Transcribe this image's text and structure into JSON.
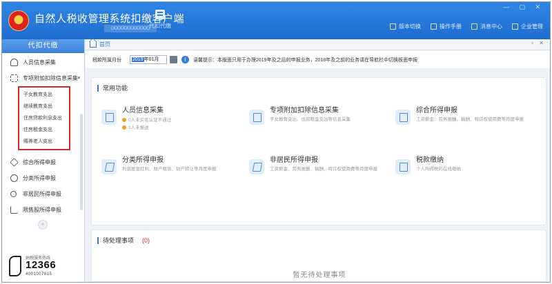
{
  "app": {
    "title": "自然人税收管理系统扣缴客户端",
    "subtitle": "（XXXXXXXXXXX）",
    "agent_label": "代扣代缴",
    "window_controls": "— ▢ ✕"
  },
  "topnav": [
    {
      "label": "版本切换"
    },
    {
      "label": "操作手册"
    },
    {
      "label": "消息中心"
    },
    {
      "label": "企业管理"
    }
  ],
  "sidebar": {
    "header": "代扣代缴",
    "items": [
      {
        "label": "人员信息采集"
      },
      {
        "label": "专项附加扣除信息采集"
      },
      {
        "label": "综合所得申报"
      },
      {
        "label": "分类所得申报"
      },
      {
        "label": "非居民所得申报"
      },
      {
        "label": "限售股所得申报"
      }
    ],
    "sub_items": [
      {
        "label": "子女教育支出"
      },
      {
        "label": "继续教育支出"
      },
      {
        "label": "住房贷款利息支出"
      },
      {
        "label": "住房租金支出"
      },
      {
        "label": "赡养老人支出"
      }
    ],
    "collapse_symbol": "«",
    "hotline": {
      "caption": "纳税服务热线",
      "number": "12366",
      "sub_number": "4001007815"
    }
  },
  "tab": {
    "label": "首页",
    "controls": "▫ ✕"
  },
  "period": {
    "label": "税款所属月份",
    "year": "2019",
    "month": "年01月",
    "tip": "温馨提示：本版面只用于办理2019年及之后的申报业务，2018年及之前的业务请在导航栏中切换板面申报"
  },
  "common_functions": {
    "title": "常用功能",
    "items": [
      {
        "title": "人员信息采集",
        "stat1": "0人未实名认证不通过",
        "stat2": "1人未报送"
      },
      {
        "title": "专项附加扣除信息采集",
        "desc": "子女教育支出、住房租金支出等信息采集"
      },
      {
        "title": "综合所得申报",
        "desc": "工资薪金、劳务报酬、稿酬、特许权使用费等月度申报"
      },
      {
        "title": "分类所得申报",
        "desc": "利息股息红利、财产租赁、财产转让等月度申报"
      },
      {
        "title": "非居民所得申报",
        "desc": "工资薪金、劳务报酬、稿酬、特许权使用费等月度申报"
      },
      {
        "title": "税款缴纳",
        "desc": "个人所得税的在线缴纳"
      }
    ]
  },
  "pending": {
    "title": "待处理事项",
    "count": "(0)",
    "empty": "暂无待处理事项"
  }
}
